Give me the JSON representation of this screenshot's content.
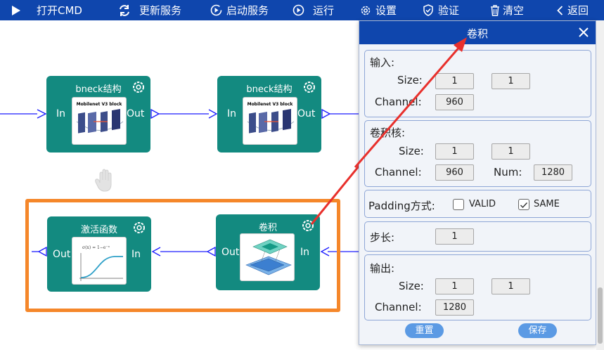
{
  "toolbar": {
    "open_cmd": "打开CMD",
    "refresh": "更新服务",
    "start": "启动服务",
    "run": "运行",
    "settings": "设置",
    "verify": "验证",
    "clear": "清空",
    "back": "返回"
  },
  "nodes": {
    "bneck1": {
      "title": "bneck结构",
      "in": "In",
      "out": "Out",
      "thumb_caption": "Mobilenet V3 block"
    },
    "bneck2": {
      "title": "bneck结构",
      "in": "In",
      "out": "Out",
      "thumb_caption": "Mobilenet V3 block"
    },
    "activation": {
      "title": "激活函数",
      "in": "In",
      "out": "Out"
    },
    "conv": {
      "title": "卷积",
      "in": "In",
      "out": "Out"
    }
  },
  "dialog": {
    "title": "卷积",
    "input": {
      "heading": "输入:",
      "size_label": "Size:",
      "size_w": "1",
      "size_h": "1",
      "channel_label": "Channel:",
      "channel": "960"
    },
    "kernel": {
      "heading": "卷积核:",
      "size_label": "Size:",
      "size_w": "1",
      "size_h": "1",
      "channel_label": "Channel:",
      "channel": "960",
      "num_label": "Num:",
      "num": "1280"
    },
    "padding": {
      "label": "Padding方式:",
      "valid": "VALID",
      "valid_checked": false,
      "same": "SAME",
      "same_checked": true
    },
    "stride": {
      "label": "步长:",
      "value": "1"
    },
    "output": {
      "heading": "输出:",
      "size_label": "Size:",
      "size_w": "1",
      "size_h": "1",
      "channel_label": "Channel:",
      "channel": "1280"
    },
    "reset": "重置",
    "save": "保存"
  },
  "colors": {
    "toolbar": "#0f46ad",
    "node": "#138a80",
    "selection": "#f5872a",
    "arrow": "#e8302c",
    "button": "#5b9ae4"
  }
}
